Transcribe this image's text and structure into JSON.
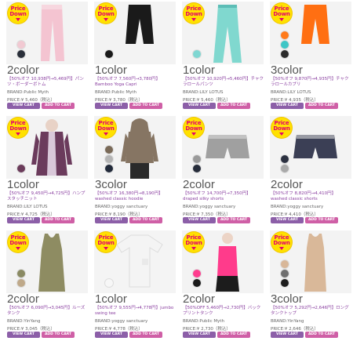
{
  "badge": {
    "line1": "Price",
    "line2": "Down"
  },
  "buttons": {
    "view": "VIEW CART",
    "cart": "ADD TO CART"
  },
  "products": [
    {
      "colors": "2color",
      "desc": "【50%オフ 10,938円→5,469円】パンツ・ボーダーボトム",
      "brand": "BRAND:Public Myth",
      "price": "PRICE:¥ 5,460（税込）",
      "swatches": [
        "#f1c9d2",
        "#2a2f3a"
      ],
      "hasBadge": true,
      "garment": "pants",
      "garment_color": "#f4c4d1"
    },
    {
      "colors": "1color",
      "desc": "【50%オフ 7,560円→3,780円】Bamboo Yoga Capri",
      "brand": "BRAND:Public Myth",
      "price": "PRICE:¥ 3,780（税込）",
      "swatches": [
        "#1a1a1a"
      ],
      "hasBadge": true,
      "garment": "capri",
      "garment_color": "#1a1a1a"
    },
    {
      "colors": "1color",
      "desc": "【50%オフ 10,920円→5,460円】チャクラロールパンツ",
      "brand": "BRAND:LILY LOTUS",
      "price": "PRICE:¥ 5,460（税込）",
      "swatches": [
        "#7fd7d2"
      ],
      "hasBadge": true,
      "garment": "longpants",
      "garment_color": "#80d8cf"
    },
    {
      "colors": "3color",
      "desc": "【50%オフ 9,870円→4,935円】チャクラロールカプリ",
      "brand": "BRAND:LILY LOTUS",
      "price": "PRICE:¥ 4,935（税込）",
      "swatches": [
        "#ff7a1a",
        "#3ec6c6",
        "#2b2b2b"
      ],
      "hasBadge": true,
      "garment": "capri",
      "garment_color": "#ff6f12"
    },
    {
      "colors": "1color",
      "desc": "【50%オフ 9,450円→4,725円】ハンプスタッチニット",
      "brand": "BRAND:LILY LOTUS",
      "price": "PRICE:¥ 4,725（税込）",
      "swatches": [
        "#6b3b5a"
      ],
      "hasBadge": true,
      "garment": "cardigan",
      "garment_color": "#6b3b5c"
    },
    {
      "colors": "3color",
      "desc": "【50%オフ 16,380円→8,190円】washed classic hoodie",
      "brand": "BRAND:yoggy sanctuary",
      "price": "PRICE:¥ 8,190（税込）",
      "swatches": [
        "#7a6a58",
        "#b5b5b5",
        "#222a3a"
      ],
      "hasBadge": true,
      "garment": "hoodie",
      "garment_color": "#867563"
    },
    {
      "colors": "2color",
      "desc": "【50%オフ 14,700円→7,350円】draped silky shorts",
      "brand": "BRAND:yoggy sanctuary",
      "price": "PRICE:¥ 7,350（税込）",
      "swatches": [
        "#9a9a9a",
        "#262c3a"
      ],
      "hasBadge": true,
      "garment": "shorts",
      "garment_color": "#a0a0a0"
    },
    {
      "colors": "2color",
      "desc": "【50%オフ 8,820円→4,410円】washed classic shorts",
      "brand": "BRAND:yoggy sanctuary",
      "price": "PRICE:¥ 4,410（税込）",
      "swatches": [
        "#2b3040",
        "#a9a9a9"
      ],
      "hasBadge": true,
      "garment": "shorts",
      "garment_color": "#3b3f55"
    },
    {
      "colors": "2color",
      "desc": "【50%オフ 6,090円→3,045円】ルーズタンク",
      "brand": "BRAND:YinYang",
      "price": "PRICE:¥ 3,045（税込）",
      "swatches": [
        "#8a8a63",
        "#bfa98a"
      ],
      "hasBadge": true,
      "garment": "tank",
      "garment_color": "#8e8c62"
    },
    {
      "colors": "1color",
      "desc": "【50%オフ 9,555円→4,778円】jumbo swing tee",
      "brand": "BRAND:yoggy sanctuary",
      "price": "PRICE:¥ 4,778（税込）",
      "swatches": [
        "#f7f7f7"
      ],
      "hasBadge": true,
      "garment": "tee",
      "garment_color": "#f4f4f4"
    },
    {
      "colors": "2color",
      "desc": "【50%OFF 5,460円→2,730円】バックプリントタンク",
      "brand": "BRAND:Public Myth",
      "price": "PRICE:¥ 2,730（税込）",
      "swatches": [
        "#ff3d8f",
        "#1b1b1b"
      ],
      "hasBadge": true,
      "garment": "cami",
      "garment_color": "#ff3b8b"
    },
    {
      "colors": "3color",
      "desc": "【50%オフ 5,292円→2,646円】ロングタンクトップ",
      "brand": "BRAND:YinYang",
      "price": "PRICE:¥ 2,646（税込）",
      "swatches": [
        "#d8b799",
        "#6f6f6f",
        "#1d1d1d"
      ],
      "hasBadge": true,
      "garment": "longtank",
      "garment_color": "#d9b899"
    }
  ]
}
